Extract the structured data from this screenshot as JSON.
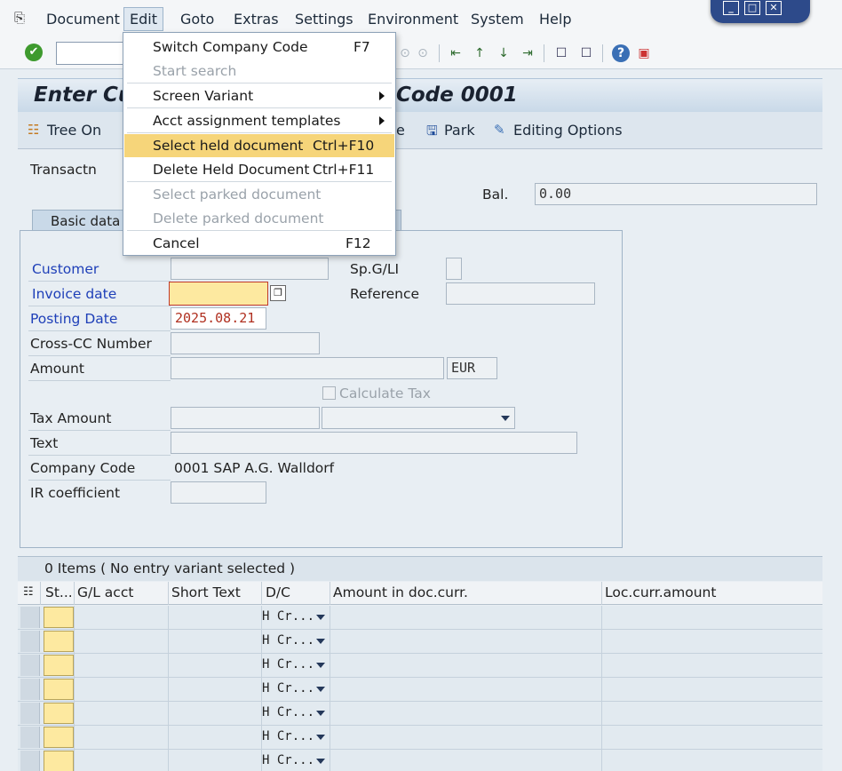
{
  "menubar": {
    "items": [
      "Document",
      "Edit",
      "Goto",
      "Extras",
      "Settings",
      "Environment",
      "System",
      "Help"
    ]
  },
  "title": {
    "left": "Enter Cu",
    "right": "Code 0001"
  },
  "apptoolbar": {
    "tree_on": "Tree On",
    "park": "Park",
    "editing_options": "Editing Options",
    "partial": "e"
  },
  "header": {
    "transaction_label": "Transactn",
    "bal_label": "Bal.",
    "bal_value": "0.00"
  },
  "tabs": {
    "basic_data": "Basic data"
  },
  "form": {
    "customer": "Customer",
    "spgl": "Sp.G/LI",
    "invoice_date": "Invoice date",
    "reference": "Reference",
    "posting_date": "Posting Date",
    "posting_date_value": "2025.08.21",
    "cross_cc": "Cross-CC Number",
    "amount": "Amount",
    "currency": "EUR",
    "calc_tax": "Calculate Tax",
    "tax_amount": "Tax Amount",
    "text": "Text",
    "company_code": "Company Code",
    "company_code_value": "0001 SAP A.G. Walldorf",
    "ir_coefficient": "IR coefficient"
  },
  "items_table": {
    "header": "0 Items ( No entry variant selected )",
    "columns": [
      "St...",
      "G/L acct",
      "Short Text",
      "D/C",
      "Amount in doc.curr.",
      "Loc.curr.amount"
    ],
    "dc_value": "H Cr..."
  },
  "edit_menu": {
    "items": [
      {
        "label": "Switch Company Code",
        "shortcut": "F7"
      },
      {
        "label": "Start search",
        "shortcut": ""
      },
      {
        "label": "Screen Variant",
        "shortcut": ""
      },
      {
        "label": "Acct assignment templates",
        "shortcut": ""
      },
      {
        "label": "Select held document",
        "shortcut": "Ctrl+F10"
      },
      {
        "label": "Delete Held Document",
        "shortcut": "Ctrl+F11"
      },
      {
        "label": "Select parked document",
        "shortcut": ""
      },
      {
        "label": "Delete parked document",
        "shortcut": ""
      },
      {
        "label": "Cancel",
        "shortcut": "F12"
      }
    ]
  },
  "colors": {
    "highlight": "#f6d57a",
    "required_blue": "#1e3fb8",
    "window_blue": "#2d4a8a"
  }
}
